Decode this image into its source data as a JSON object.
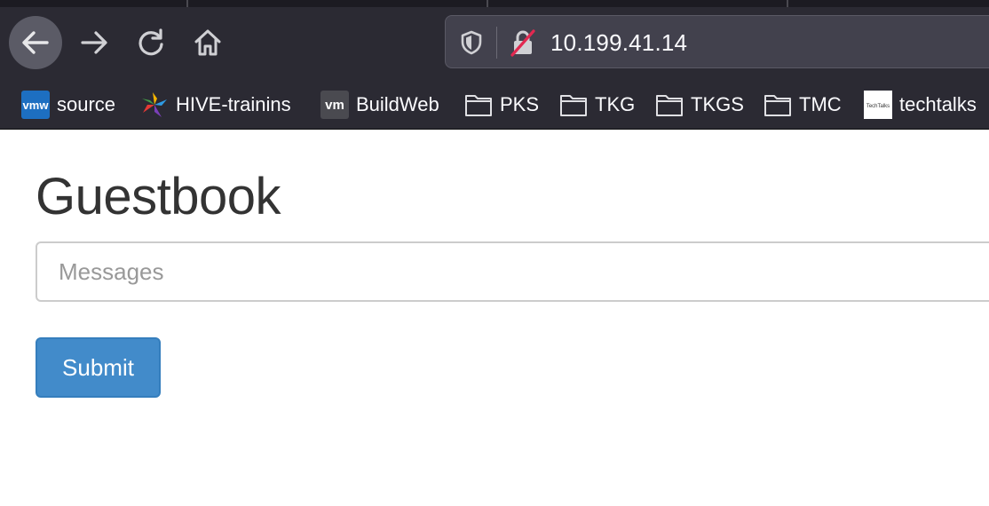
{
  "browser": {
    "address": "10.199.41.14",
    "bookmarks": [
      {
        "label": "source",
        "icon": "vmw-icon",
        "icon_text": "vmw"
      },
      {
        "label": "HIVE-trainins",
        "icon": "hive-logo-icon"
      },
      {
        "label": "BuildWeb",
        "icon": "vm-icon",
        "icon_text": "vm"
      },
      {
        "label": "PKS",
        "icon": "folder-icon"
      },
      {
        "label": "TKG",
        "icon": "folder-icon"
      },
      {
        "label": "TKGS",
        "icon": "folder-icon"
      },
      {
        "label": "TMC",
        "icon": "folder-icon"
      },
      {
        "label": "techtalks",
        "icon": "techtalks-icon",
        "icon_text": "TechTalks"
      }
    ]
  },
  "page": {
    "title": "Guestbook",
    "input_placeholder": "Messages",
    "submit_label": "Submit"
  },
  "colors": {
    "chrome_bg": "#2b2a33",
    "urlbar_bg": "#42414d",
    "primary_button": "#428bca",
    "title_text": "#333333"
  }
}
